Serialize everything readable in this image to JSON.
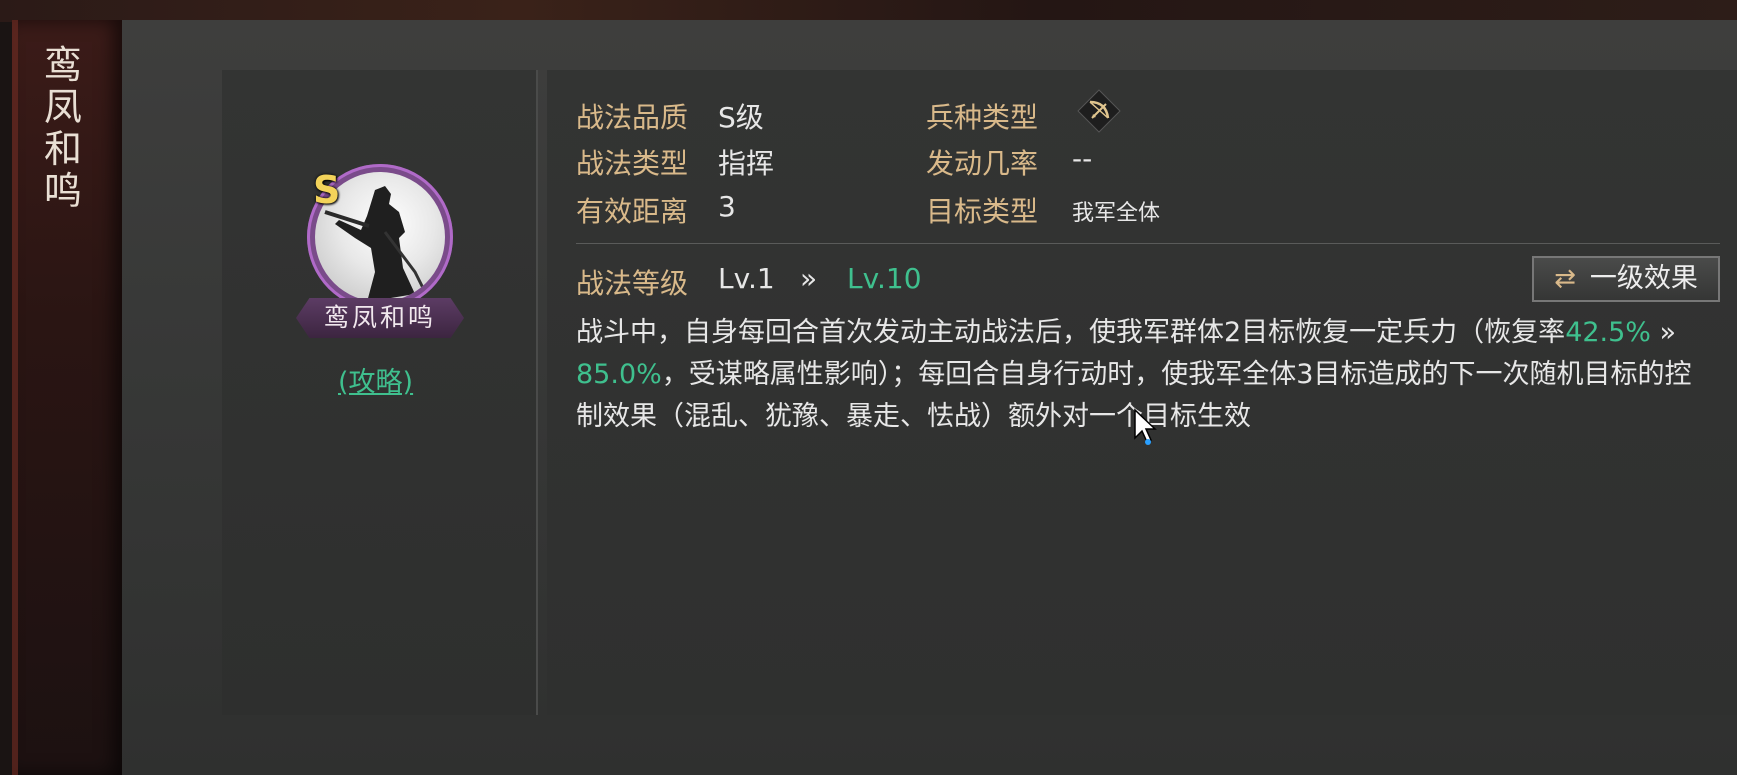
{
  "banner": {
    "title_chars": [
      "鸾",
      "凤",
      "和",
      "鸣"
    ]
  },
  "skill": {
    "grade": "S",
    "name_plate": "鸾凤和鸣",
    "guide_link": "(攻略)"
  },
  "info": {
    "quality_label": "战法品质",
    "quality_value": "S级",
    "troop_label": "兵种类型",
    "troop_icon": "bow-crossed-icon",
    "type_label": "战法类型",
    "type_value": "指挥",
    "trigger_label": "发动几率",
    "trigger_value": "--",
    "range_label": "有效距离",
    "range_value": "3",
    "target_label": "目标类型",
    "target_value": "我军全体"
  },
  "level": {
    "label": "战法等级",
    "from": "Lv.1",
    "arrow": "»",
    "to": "Lv.10",
    "effect_button": "一级效果"
  },
  "description": {
    "part1": "战斗中，自身每回合首次发动主动战法后，使我军群体2目标恢复一定兵力（恢复率",
    "rate_from": "42.5%",
    "arrow": " » ",
    "rate_to": "85.0%",
    "part2": "，受谋略属性影响）；每回合自身行动时，使我军全体3目标造成的下一次随机目标的控制效果（混乱、犹豫、暴走、怯战）额外对一个目标生效"
  },
  "colors": {
    "accent_green": "#3fc08e",
    "label_gold": "#d9b98a",
    "grade_yellow": "#f3d35a",
    "frame_purple": "#b06ac8"
  }
}
